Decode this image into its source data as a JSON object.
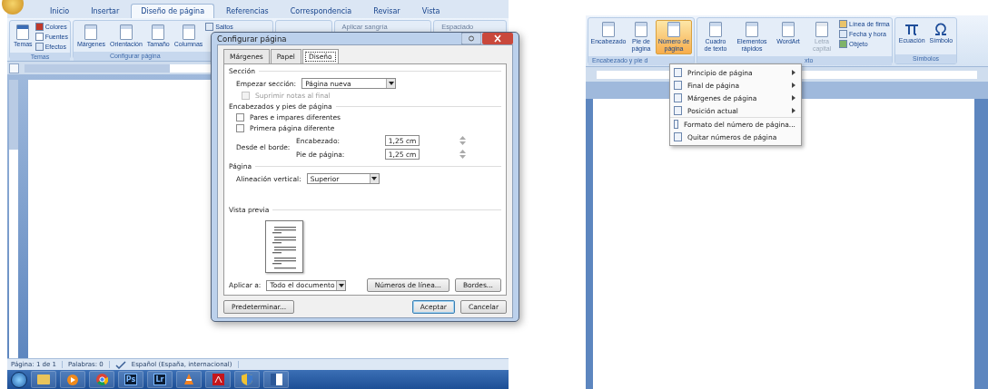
{
  "word_window": {
    "ribbon_tabs": [
      {
        "label": "Inicio",
        "selected": false
      },
      {
        "label": "Insertar",
        "selected": false
      },
      {
        "label": "Diseño de página",
        "selected": true
      },
      {
        "label": "Referencias",
        "selected": false
      },
      {
        "label": "Correspondencia",
        "selected": false
      },
      {
        "label": "Revisar",
        "selected": false
      },
      {
        "label": "Vista",
        "selected": false
      }
    ],
    "temas_group": {
      "label": "Temas",
      "big_button": "Temas",
      "small_buttons": [
        "Colores",
        "Fuentes",
        "Efectos"
      ]
    },
    "configurar_group": {
      "label": "Configurar página",
      "big_buttons": [
        "Márgenes",
        "Orientación",
        "Tamaño",
        "Columnas"
      ],
      "small_buttons": [
        "Saltos"
      ]
    },
    "paragraph_headers": [
      "Aplicar sangría",
      "Espaciado"
    ],
    "status_bar": {
      "page": "Página: 1 de 1",
      "words": "Palabras: 0",
      "language": "Español (España, internacional)"
    },
    "taskbar_apps": [
      {
        "kind": "explorer"
      },
      {
        "kind": "media"
      },
      {
        "kind": "chrome"
      },
      {
        "kind": "text",
        "label": "Ps"
      },
      {
        "kind": "text",
        "label": "Lr"
      },
      {
        "kind": "cone"
      },
      {
        "kind": "pdf"
      },
      {
        "kind": "shield"
      },
      {
        "kind": "word"
      }
    ]
  },
  "dialog": {
    "title": "Configurar página",
    "tabs": [
      {
        "label": "Márgenes",
        "selected": false
      },
      {
        "label": "Papel",
        "selected": false
      },
      {
        "label": "Diseño",
        "selected": true
      }
    ],
    "section_heading": "Sección",
    "start_label": "Empezar sección:",
    "start_value": "Página nueva",
    "suppress": {
      "label": "Suprimir notas al final",
      "checked": false,
      "disabled": true
    },
    "headers_heading": "Encabezados y pies de página",
    "header_checks": [
      {
        "label": "Pares e impares diferentes",
        "checked": false,
        "disabled": false
      },
      {
        "label": "Primera página diferente",
        "checked": false,
        "disabled": false
      }
    ],
    "from_edge_label": "Desde el borde:",
    "header_label": "Encabezado:",
    "header_value": "1,25 cm",
    "footer_label": "Pie de página:",
    "footer_value": "1,25 cm",
    "page_heading": "Página",
    "align_label": "Alineación vertical:",
    "align_value": "Superior",
    "preview_heading": "Vista previa",
    "apply_label": "Aplicar a:",
    "apply_value": "Todo el documento",
    "line_numbers_button": "Números de línea...",
    "borders_button": "Bordes...",
    "default_button": "Predeterminar...",
    "ok_button": "Aceptar",
    "cancel_button": "Cancelar"
  },
  "insert_ribbon": {
    "header_group": {
      "label": "Encabezado y pie d",
      "buttons": [
        {
          "label": "Encabezado",
          "selected": false
        },
        {
          "label": "Pie de página",
          "selected": false
        },
        {
          "label": "Número de página",
          "selected": true
        }
      ]
    },
    "text_group": {
      "label": "xto",
      "buttons": [
        {
          "label": "Cuadro de texto",
          "disabled": false
        },
        {
          "label": "Elementos rápidos",
          "disabled": false
        },
        {
          "label": "WordArt",
          "disabled": false
        },
        {
          "label": "Letra capital",
          "disabled": true
        }
      ],
      "small_buttons": [
        "Línea de firma",
        "Fecha y hora",
        "Objeto"
      ]
    },
    "symbols_group": {
      "label": "Símbolos",
      "buttons": [
        "Ecuación",
        "Símbolo"
      ]
    },
    "menu": [
      {
        "label": "Principio de página",
        "submenu": true
      },
      {
        "label": "Final de página",
        "submenu": true
      },
      {
        "label": "Márgenes de página",
        "submenu": true
      },
      {
        "label": "Posición actual",
        "submenu": true
      },
      {
        "label": "Formato del número de página...",
        "submenu": false
      },
      {
        "label": "Quitar números de página",
        "submenu": false
      }
    ]
  }
}
